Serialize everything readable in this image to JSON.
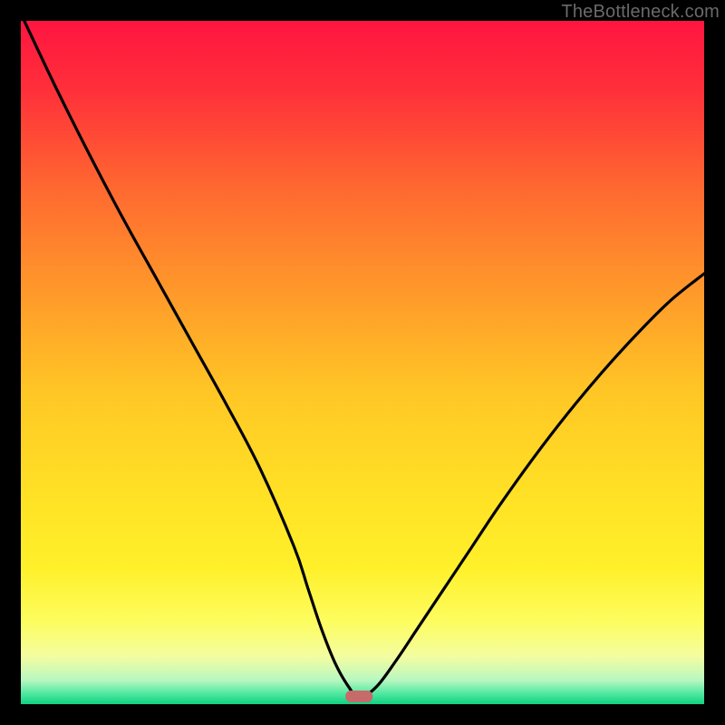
{
  "watermark": "TheBottleneck.com",
  "chart_data": {
    "type": "line",
    "title": "",
    "xlabel": "",
    "ylabel": "",
    "xlim": [
      0,
      100
    ],
    "ylim": [
      0,
      100
    ],
    "series": [
      {
        "name": "curve",
        "x": [
          0.5,
          5,
          10,
          15,
          20,
          25,
          30,
          35,
          40,
          42,
          44,
          46,
          48,
          49.5,
          52,
          55,
          58,
          62,
          66,
          70,
          75,
          80,
          85,
          90,
          95,
          100
        ],
        "y": [
          100,
          90.5,
          80.5,
          71,
          62,
          53,
          44,
          34.5,
          23,
          17,
          11,
          6,
          2.5,
          1,
          2.5,
          6.5,
          11,
          17,
          23,
          29,
          36,
          42.5,
          48.5,
          54,
          59,
          63
        ]
      }
    ],
    "marker": {
      "x": 49.5,
      "y": 1.2,
      "color": "#c76a6a"
    },
    "gradient_stops": [
      {
        "offset": 0.0,
        "color": "#ff1540"
      },
      {
        "offset": 0.1,
        "color": "#ff2f3a"
      },
      {
        "offset": 0.25,
        "color": "#ff6a30"
      },
      {
        "offset": 0.4,
        "color": "#ff9a2a"
      },
      {
        "offset": 0.55,
        "color": "#ffc825"
      },
      {
        "offset": 0.7,
        "color": "#ffe225"
      },
      {
        "offset": 0.8,
        "color": "#fff02a"
      },
      {
        "offset": 0.88,
        "color": "#fdfd60"
      },
      {
        "offset": 0.93,
        "color": "#f4fda0"
      },
      {
        "offset": 0.965,
        "color": "#b8f7c0"
      },
      {
        "offset": 0.985,
        "color": "#4de8a0"
      },
      {
        "offset": 1.0,
        "color": "#10d080"
      }
    ]
  }
}
